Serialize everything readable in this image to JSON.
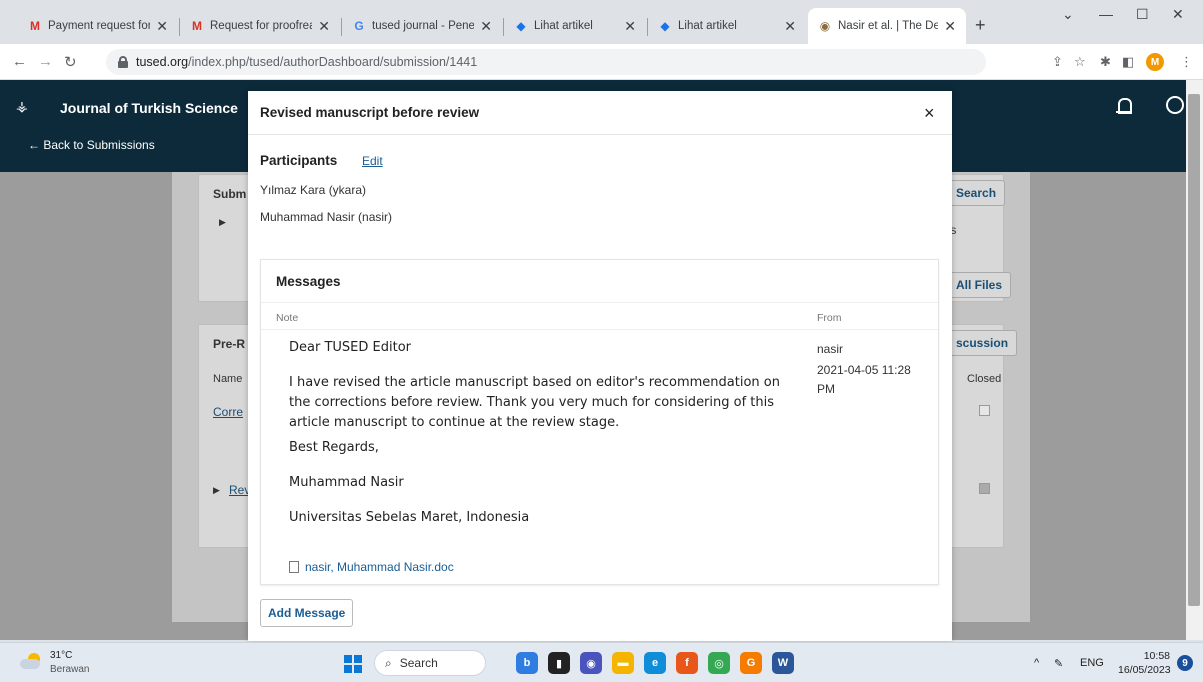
{
  "browser": {
    "tabs": [
      {
        "icon": "gmail-icon",
        "label": "Payment request for",
        "active": false
      },
      {
        "icon": "gmail-icon",
        "label": "Request for proofreac",
        "active": false
      },
      {
        "icon": "google-icon",
        "label": "tused journal - Penel",
        "active": false
      },
      {
        "icon": "ojs-icon",
        "label": "Lihat artikel",
        "active": false
      },
      {
        "icon": "ojs-icon",
        "label": "Lihat artikel",
        "active": false
      },
      {
        "icon": "site-icon",
        "label": "Nasir et al. | The Deve",
        "active": true
      }
    ],
    "url_host": "tused.org",
    "url_path": "/index.php/tused/authorDashboard/submission/1441",
    "profile_initial": "M"
  },
  "site": {
    "journal_title": "Journal of Turkish Science",
    "back_link": "← Back to Submissions"
  },
  "background": {
    "submission_heading": "Subm",
    "search_button": "Search",
    "files_text": "ts",
    "all_files_button": "All Files",
    "prereview_heading": "Pre-R",
    "discussion_button": "scussion",
    "col_name": "Name",
    "col_closed": "Closed",
    "row1_link": "Corre",
    "row2_link": "Rev"
  },
  "modal": {
    "title": "Revised manuscript before review",
    "close": "×",
    "participants_label": "Participants",
    "edit_label": "Edit",
    "participants": [
      "Yılmaz Kara (ykara)",
      "Muhammad Nasir (nasir)"
    ],
    "messages_title": "Messages",
    "col_note": "Note",
    "col_from": "From",
    "note_lines": [
      "Dear TUSED Editor",
      "I have revised the article manuscript based on editor's recommendation on the corrections before review. Thank you very much for considering of this article manuscript to continue at the review stage.",
      "Best Regards,",
      "Muhammad Nasir",
      "Universitas Sebelas Maret, Indonesia"
    ],
    "from_user": "nasir",
    "from_date": "2021-04-05 11:28 PM",
    "attachment": "nasir, Muhammad Nasir.doc",
    "add_message": "Add Message"
  },
  "taskbar": {
    "temperature": "31°C",
    "weather": "Berawan",
    "search": "Search",
    "lang": "ENG",
    "time": "10:58",
    "date": "16/05/2023",
    "notifications": "9"
  }
}
